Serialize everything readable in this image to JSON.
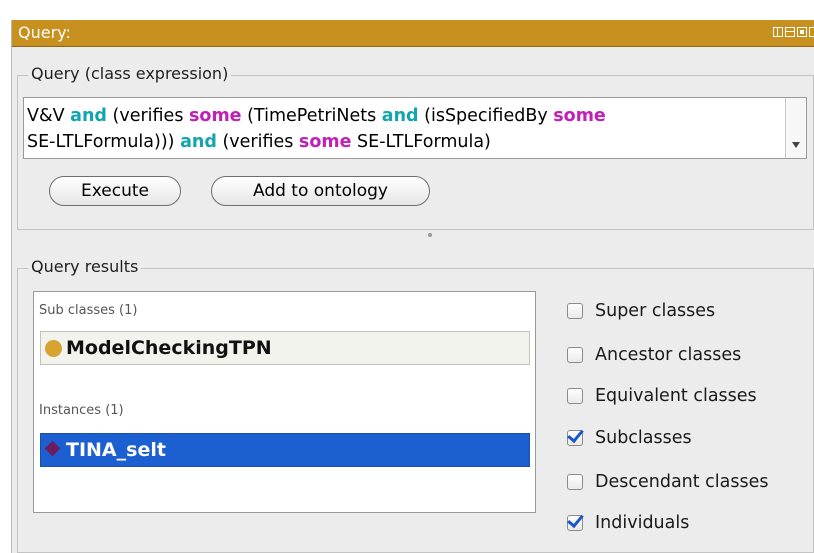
{
  "window": {
    "title": "Query:"
  },
  "query_group": {
    "legend": "Query (class expression)",
    "expression": [
      {
        "text": "V&V ",
        "style": "plain"
      },
      {
        "text": "and",
        "style": "teal"
      },
      {
        "text": " (verifies ",
        "style": "plain"
      },
      {
        "text": "some",
        "style": "pink"
      },
      {
        "text": " (TimePetriNets ",
        "style": "plain"
      },
      {
        "text": "and",
        "style": "teal"
      },
      {
        "text": " (isSpecifiedBy ",
        "style": "plain"
      },
      {
        "text": "some",
        "style": "pink"
      },
      {
        "text": "\nSE-LTLFormula))) ",
        "style": "plain"
      },
      {
        "text": "and",
        "style": "teal"
      },
      {
        "text": " (verifies ",
        "style": "plain"
      },
      {
        "text": "some",
        "style": "pink"
      },
      {
        "text": " SE-LTLFormula)",
        "style": "plain"
      }
    ],
    "execute_label": "Execute",
    "add_label": "Add to ontology"
  },
  "results_group": {
    "legend": "Query results",
    "subclasses_header": "Sub classes (1)",
    "subclasses": [
      {
        "label": "ModelCheckingTPN",
        "icon": "class-circle-icon"
      }
    ],
    "instances_header": "Instances (1)",
    "instances": [
      {
        "label": "TINA_selt",
        "icon": "individual-diamond-icon",
        "selected": true
      }
    ]
  },
  "options": [
    {
      "label": "Super classes",
      "checked": false
    },
    {
      "label": "Ancestor classes",
      "checked": false
    },
    {
      "label": "Equivalent classes",
      "checked": false
    },
    {
      "label": "Subclasses",
      "checked": true
    },
    {
      "label": "Descendant classes",
      "checked": false
    },
    {
      "label": "Individuals",
      "checked": true
    }
  ],
  "colors": {
    "titlebar": "#c8901e",
    "keyword_and": "#12a5ae",
    "keyword_some": "#c21fb5",
    "selection": "#1c5fd0",
    "class_icon": "#d7a331",
    "individual_icon": "#6e1b5f"
  }
}
